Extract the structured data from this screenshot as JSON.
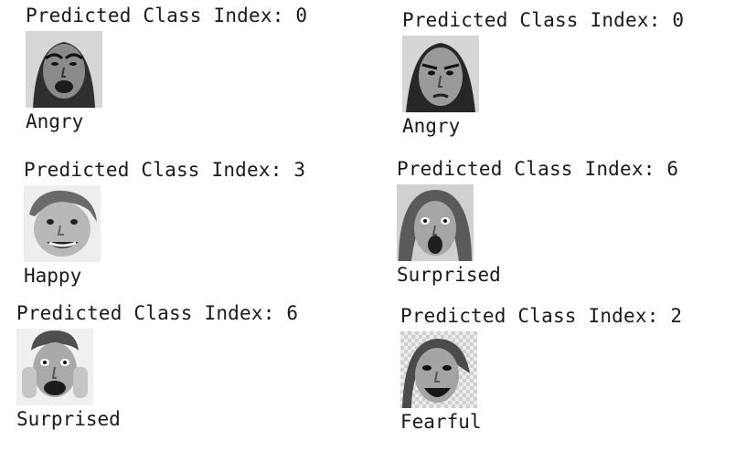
{
  "results": [
    {
      "prediction": "Predicted Class Index: 0",
      "label": "Angry",
      "face": "angry-woman-face"
    },
    {
      "prediction": "Predicted Class Index: 0",
      "label": "Angry",
      "face": "angry-woman-face"
    },
    {
      "prediction": "Predicted Class Index: 3",
      "label": "Happy",
      "face": "happy-boy-face"
    },
    {
      "prediction": "Predicted Class Index: 6",
      "label": "Surprised",
      "face": "surprised-woman-face"
    },
    {
      "prediction": "Predicted Class Index: 6",
      "label": "Surprised",
      "face": "surprised-man-face"
    },
    {
      "prediction": "Predicted Class Index: 2",
      "label": "Fearful",
      "face": "fearful-woman-face"
    }
  ],
  "colors": {
    "text": "#1a1a1a",
    "background": "#ffffff",
    "photo_gray": "#d8d8d8"
  }
}
